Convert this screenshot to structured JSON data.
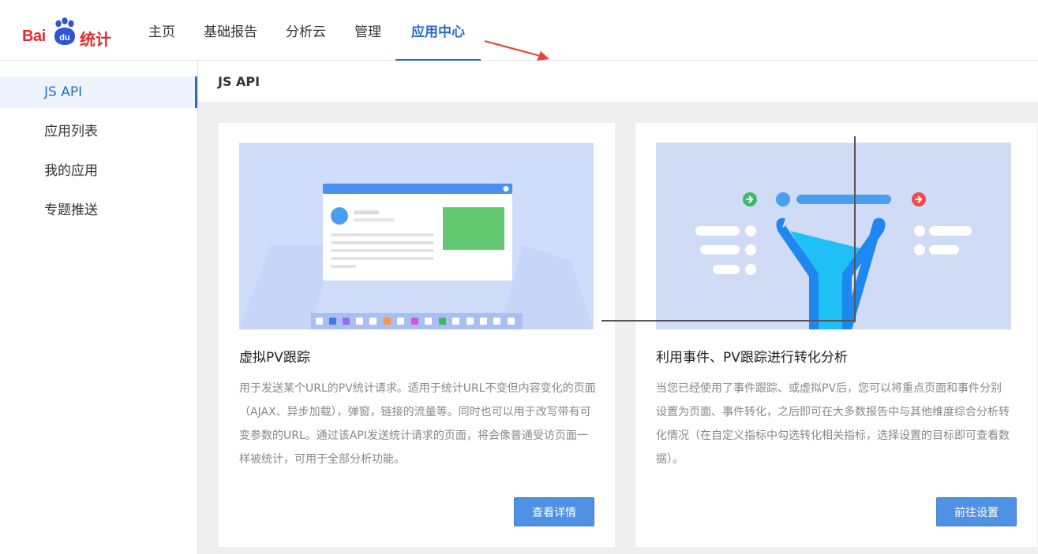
{
  "logo": {
    "text_bai": "Bai",
    "text_du": "du",
    "text_stat": "统计"
  },
  "nav": [
    {
      "label": "主页",
      "active": false
    },
    {
      "label": "基础报告",
      "active": false
    },
    {
      "label": "分析云",
      "active": false
    },
    {
      "label": "管理",
      "active": false
    },
    {
      "label": "应用中心",
      "active": true
    }
  ],
  "sidebar": [
    {
      "label": "JS API",
      "active": true
    },
    {
      "label": "应用列表",
      "active": false
    },
    {
      "label": "我的应用",
      "active": false
    },
    {
      "label": "专题推送",
      "active": false
    }
  ],
  "content": {
    "header": "JS API",
    "cards": [
      {
        "title": "虚拟PV跟踪",
        "description": "用于发送某个URL的PV统计请求。适用于统计URL不变但内容变化的页面（AJAX、异步加载），弹窗，链接的流量等。同时也可以用于改写带有可变参数的URL。通过该API发送统计请求的页面，将会像普通受访页面一样被统计，可用于全部分析功能。",
        "button": "查看详情",
        "illustration": "virtual-pv-illustration"
      },
      {
        "title": "利用事件、PV跟踪进行转化分析",
        "description": "当您已经使用了事件跟踪、或虚拟PV后，您可以将重点页面和事件分别设置为页面、事件转化，之后即可在大多数报告中与其他维度综合分析转化情况（在自定义指标中勾选转化相关指标，选择设置的目标即可查看数据）。",
        "button": "前往设置",
        "illustration": "funnel-illustration"
      }
    ]
  },
  "colors": {
    "accent": "#2a6bcc",
    "button": "#4f92e3",
    "brand_red": "#e62a2a",
    "brand_blue": "#2f55d4"
  }
}
